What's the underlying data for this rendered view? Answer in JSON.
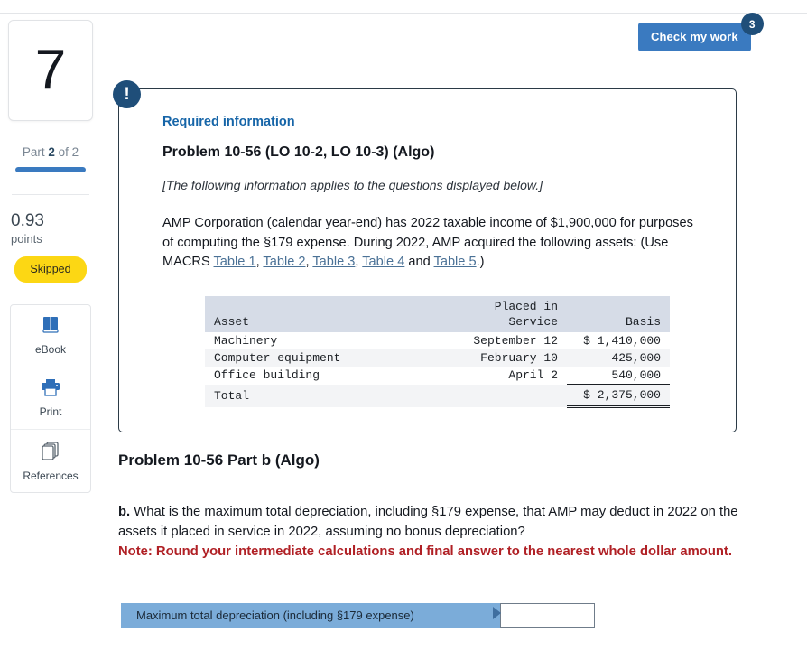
{
  "header": {
    "check_work_label": "Check my work",
    "check_work_badge": "3"
  },
  "sidebar": {
    "question_number": "7",
    "part_prefix": "Part ",
    "part_current": "2",
    "part_suffix": " of 2",
    "progress_percent": 100,
    "points_value": "0.93",
    "points_label": "points",
    "status_badge": "Skipped",
    "tools": [
      {
        "label": "eBook",
        "icon": "book-icon"
      },
      {
        "label": "Print",
        "icon": "printer-icon"
      },
      {
        "label": "References",
        "icon": "copy-pages-icon"
      }
    ]
  },
  "info_card": {
    "alert_icon": "exclamation-icon",
    "required_information": "Required information",
    "problem_title": "Problem 10-56 (LO 10-2, LO 10-3) (Algo)",
    "applies_note": "[The following information applies to the questions displayed below.]",
    "paragraph": {
      "part1": "AMP Corporation (calendar year-end) has 2022 taxable income of $1,900,000 for purposes of computing the §179 expense. During 2022, AMP acquired the following assets: (Use MACRS ",
      "links": [
        "Table 1",
        "Table 2",
        "Table 3",
        "Table 4",
        "Table 5"
      ],
      "mid": " and ",
      "part2": ".)"
    },
    "table": {
      "columns": [
        "Asset",
        "Placed in\nService",
        "Basis"
      ],
      "rows": [
        {
          "asset": "Machinery",
          "placed_in_service": "September 12",
          "basis": "$ 1,410,000"
        },
        {
          "asset": "Computer equipment",
          "placed_in_service": "February 10",
          "basis": "425,000"
        },
        {
          "asset": "Office building",
          "placed_in_service": "April 2",
          "basis": "540,000"
        }
      ],
      "total_label": "Total",
      "total_basis": "$ 2,375,000"
    }
  },
  "question": {
    "part_title": "Problem 10-56 Part b (Algo)",
    "marker": "b.",
    "text": " What is the maximum total depreciation, including §179 expense, that AMP may deduct in 2022 on the assets it placed in service in 2022, assuming no bonus depreciation?",
    "note": "Note: Round your intermediate calculations and final answer to the nearest whole dollar amount."
  },
  "answer": {
    "label": "Maximum total depreciation (including §179 expense)",
    "value": "",
    "placeholder": ""
  },
  "colors": {
    "accent_blue": "#3a7ac0",
    "dark_navy": "#1f4e79",
    "link_blue": "#4a7196",
    "note_red": "#b02025",
    "badge_yellow": "#fcd714",
    "answer_label_blue": "#7bacd9",
    "table_header_bg": "#d6dce7"
  }
}
